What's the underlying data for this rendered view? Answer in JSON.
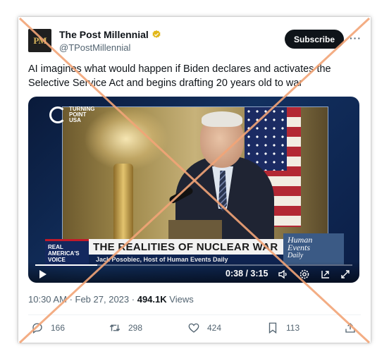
{
  "account": {
    "name": "The Post Millennial",
    "handle": "@TPostMillennial",
    "avatar_text": "PM",
    "verified_color": "#e2b719"
  },
  "header": {
    "subscribe_label": "Subscribe",
    "more_label": "···"
  },
  "tweet": {
    "text": "AI imagines what would happen if Biden declares and activates the Selective Service Act and begins drafting 20 years old to war"
  },
  "video": {
    "channel_logo": "TURNING POINT USA",
    "lower_third_logo": "REAL AMERICA'S VOICE",
    "headline": "THE REALITIES OF NUCLEAR WAR",
    "subheadline": "Jack Posobiec, Host of Human Events Daily",
    "show_line1": "Human",
    "show_line2": "Events",
    "show_line3": "Daily",
    "time": "0:38 / 3:15",
    "progress_fraction": 0.195,
    "icons": [
      "play-icon",
      "volume-icon",
      "settings-icon",
      "pip-icon",
      "fullscreen-icon"
    ]
  },
  "meta": {
    "time": "10:30 AM",
    "date": "Feb 27, 2023",
    "views_count": "494.1K",
    "views_label": "Views"
  },
  "actions": {
    "replies": "166",
    "retweets": "298",
    "likes": "424",
    "bookmarks": "113"
  },
  "overlay": {
    "x_color": "#f2a477"
  }
}
